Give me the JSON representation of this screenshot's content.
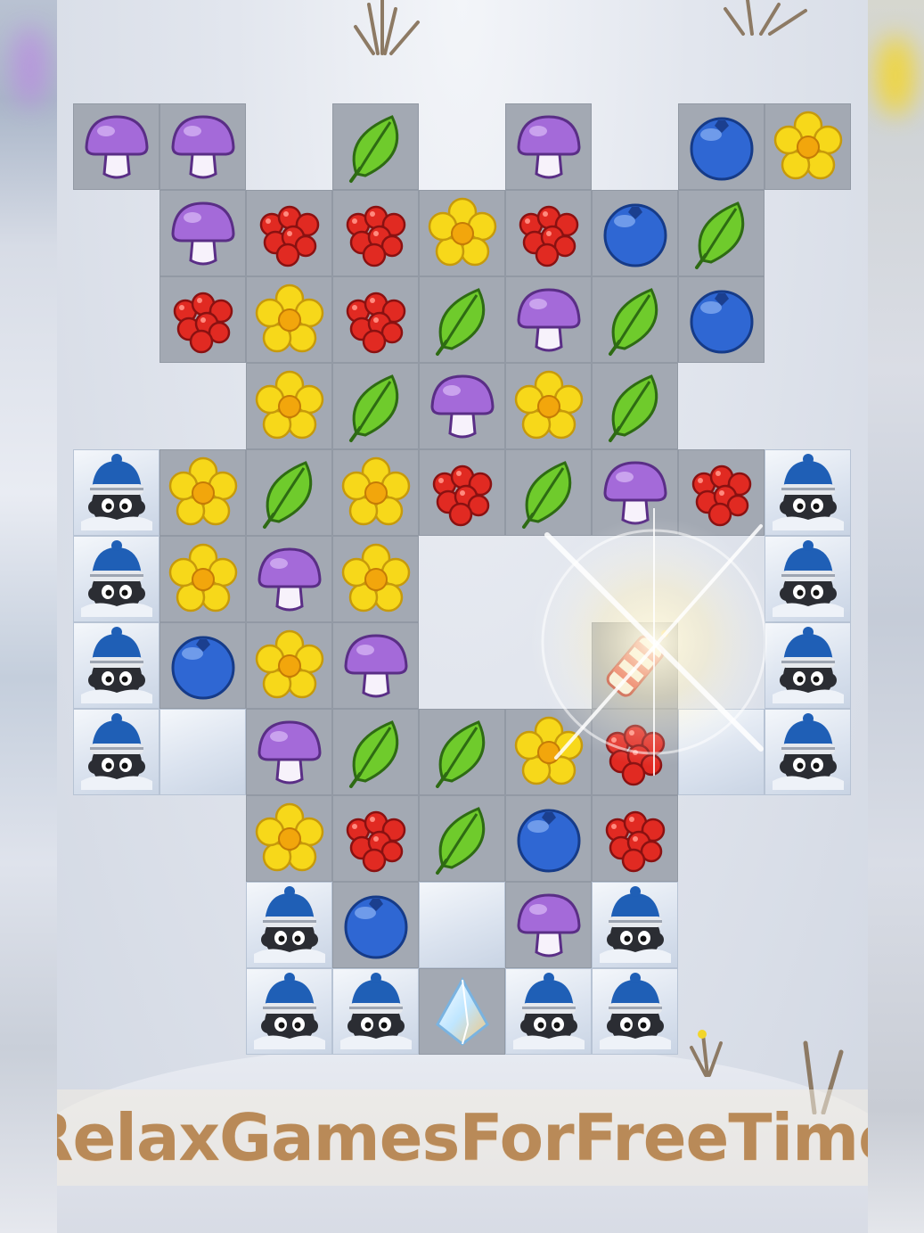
{
  "watermark": {
    "text": "RelaxGamesForFreeTime"
  },
  "board": {
    "rows": 11,
    "cols": 9,
    "cells": [
      [
        "mushroom",
        "mushroom",
        null,
        "leaf",
        null,
        "mushroom",
        null,
        "blueberry",
        "flower"
      ],
      [
        null,
        "mushroom",
        "raspberry",
        "raspberry",
        "flower",
        "raspberry",
        "blueberry",
        "leaf",
        null
      ],
      [
        null,
        "raspberry",
        "flower",
        "raspberry",
        "leaf",
        "mushroom",
        "leaf",
        "blueberry",
        null
      ],
      [
        null,
        null,
        "flower",
        "leaf",
        "mushroom",
        "flower",
        "leaf",
        null,
        null
      ],
      [
        "yeti",
        "flower",
        "leaf",
        "flower",
        "raspberry",
        "leaf",
        "mushroom",
        "raspberry",
        "yeti"
      ],
      [
        "yeti",
        "flower",
        "mushroom",
        "flower",
        null,
        null,
        null,
        null,
        "yeti"
      ],
      [
        "yeti",
        "blueberry",
        "flower",
        "mushroom",
        null,
        null,
        "firecracker",
        null,
        "yeti"
      ],
      [
        "yeti",
        "snow",
        "mushroom",
        "leaf",
        "leaf",
        "flower",
        "raspberry",
        "snow",
        "yeti"
      ],
      [
        null,
        null,
        "flower",
        "raspberry",
        "leaf",
        "blueberry",
        "raspberry",
        null,
        null
      ],
      [
        null,
        null,
        "yeti",
        "blueberry",
        "snow",
        "mushroom",
        "yeti",
        null,
        null
      ],
      [
        null,
        null,
        "yeti",
        "yeti",
        "crystal",
        "yeti",
        "yeti",
        null,
        null
      ]
    ]
  },
  "colors": {
    "tile": "#a3a9b3",
    "snow": "#dbe3ef",
    "mushroom": "#a46ad9",
    "raspberry": "#e12a22",
    "leaf": "#6fcb2c",
    "flower": "#f7d81a",
    "blueberry": "#2f67d3",
    "yeti_hat": "#1f5fb6"
  }
}
